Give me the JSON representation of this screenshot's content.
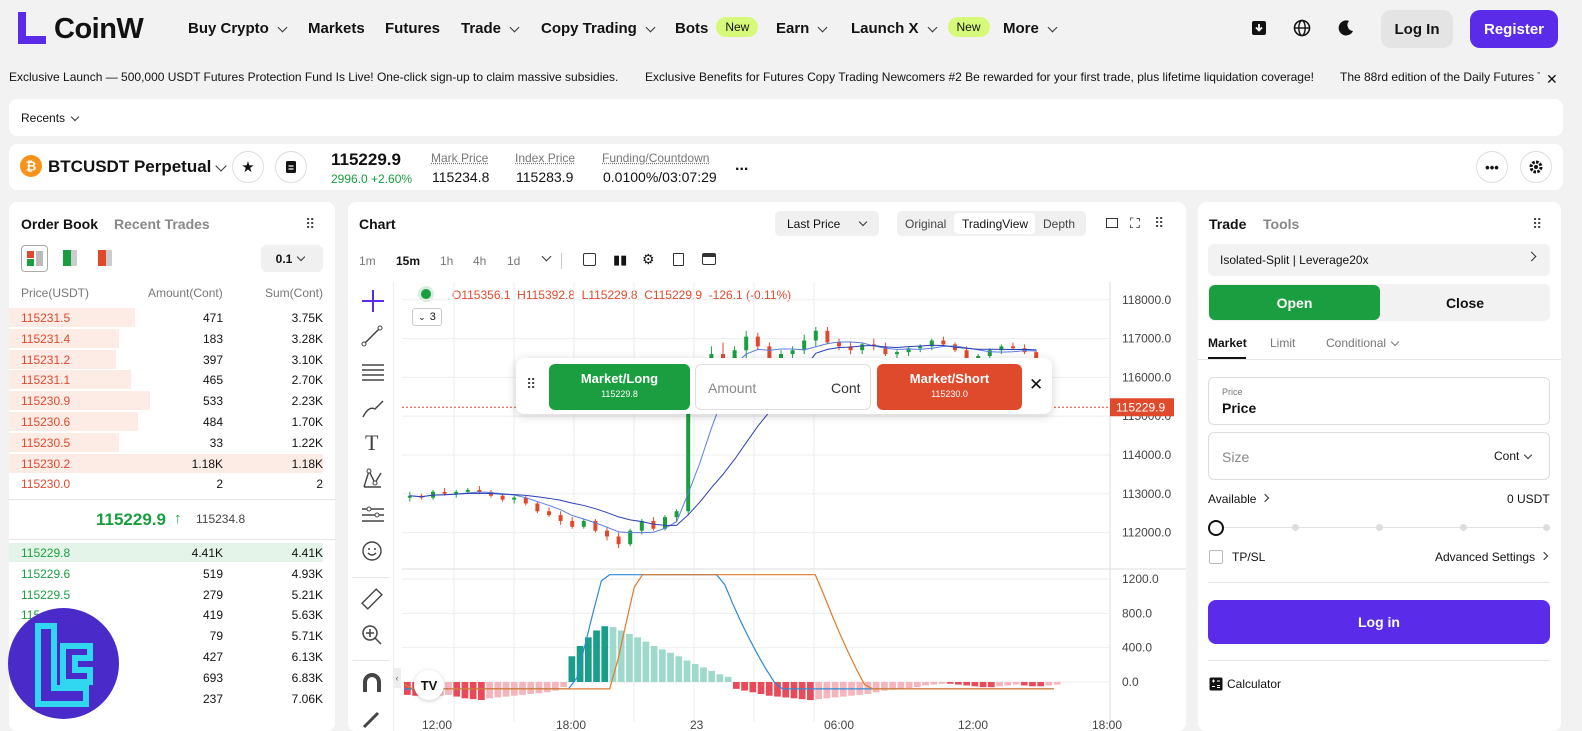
{
  "brand": {
    "name": "CoinW",
    "color": "#5a2be8"
  },
  "nav": {
    "items": [
      {
        "label": "Buy Crypto",
        "chevron": true
      },
      {
        "label": "Markets"
      },
      {
        "label": "Futures"
      },
      {
        "label": "Trade",
        "chevron": true
      },
      {
        "label": "Copy Trading",
        "chevron": true
      },
      {
        "label": "Bots",
        "badge": "New"
      },
      {
        "label": "Earn",
        "chevron": true
      },
      {
        "label": "Launch X",
        "chevron": true,
        "badge": "New"
      },
      {
        "label": "More",
        "chevron": true
      }
    ],
    "login": "Log In",
    "register": "Register"
  },
  "ticker": {
    "items": [
      "Exclusive Launch — 500,000 USDT Futures Protection Fund Is Live! One-click sign-up to claim massive subsidies.",
      "Exclusive Benefits for Futures Copy Trading Newcomers #2 Be rewarded for your first trade, plus lifetime liquidation coverage!",
      "The 88rd edition of the Daily Futures T"
    ]
  },
  "recents": "Recents",
  "symbol": {
    "name": "BTCUSDT Perpetual",
    "last": "115229.9",
    "change": "2996.0 +2.60%",
    "mark_label": "Mark Price",
    "mark": "115234.8",
    "index_label": "Index Price",
    "index": "115283.9",
    "funding_label": "Funding/Countdown",
    "funding": "0.0100%/03:07:29",
    "more": "..."
  },
  "orderbook": {
    "tabs": [
      "Order Book",
      "Recent Trades"
    ],
    "precision": "0.1",
    "headers": [
      "Price(USDT)",
      "Amount(Cont)",
      "Sum(Cont)"
    ],
    "asks": [
      {
        "price": "115231.5",
        "amount": "471",
        "sum": "3.75K",
        "depth": 0.4
      },
      {
        "price": "115231.4",
        "amount": "183",
        "sum": "3.28K",
        "depth": 0.35
      },
      {
        "price": "115231.2",
        "amount": "397",
        "sum": "3.10K",
        "depth": 0.34
      },
      {
        "price": "115231.1",
        "amount": "465",
        "sum": "2.70K",
        "depth": 0.39
      },
      {
        "price": "115230.9",
        "amount": "533",
        "sum": "2.23K",
        "depth": 0.45
      },
      {
        "price": "115230.6",
        "amount": "484",
        "sum": "1.70K",
        "depth": 0.41
      },
      {
        "price": "115230.5",
        "amount": "33",
        "sum": "1.22K",
        "depth": 0.35
      },
      {
        "price": "115230.2",
        "amount": "1.18K",
        "sum": "1.18K",
        "depth": 1.0
      },
      {
        "price": "115230.0",
        "amount": "2",
        "sum": "2",
        "depth": 0.0
      }
    ],
    "mid_price": "115229.9",
    "mid_mark": "115234.8",
    "bids": [
      {
        "price": "115229.8",
        "amount": "4.41K",
        "sum": "4.41K",
        "depth": 1.0
      },
      {
        "price": "115229.6",
        "amount": "519",
        "sum": "4.93K",
        "depth": 0.0
      },
      {
        "price": "115229.5",
        "amount": "279",
        "sum": "5.21K",
        "depth": 0.0
      },
      {
        "price": "115...",
        "amount": "419",
        "sum": "5.63K",
        "depth": 0.0
      },
      {
        "price": "",
        "amount": "79",
        "sum": "5.71K",
        "depth": 0.0
      },
      {
        "price": "",
        "amount": "427",
        "sum": "6.13K",
        "depth": 0.0
      },
      {
        "price": "",
        "amount": "693",
        "sum": "6.83K",
        "depth": 0.0
      },
      {
        "price": "",
        "amount": "237",
        "sum": "7.06K",
        "depth": 0.0
      }
    ]
  },
  "chart": {
    "title": "Chart",
    "price_type": "Last Price",
    "views": [
      "Original",
      "TradingView",
      "Depth"
    ],
    "intervals": [
      "1m",
      "15m",
      "1h",
      "4h",
      "1d"
    ],
    "ohlc": {
      "o": "O115356.1",
      "h": "H115392.8",
      "l": "L115229.8",
      "c": "C115229.9",
      "chg": "-126.1 (-0.11%)"
    },
    "indicator_count": "3",
    "price_axis": [
      "118000.0",
      "117000.0",
      "116000.0",
      "115000.0",
      "114000.0",
      "113000.0",
      "112000.0"
    ],
    "last_price_tag": "115229.9",
    "macd_axis": [
      "1200.0",
      "800.0",
      "400.0",
      "0.0"
    ],
    "time_axis": [
      "12:00",
      "18:00",
      "23",
      "06:00",
      "12:00",
      "18:00"
    ],
    "quick": {
      "long": "Market/Long",
      "long_price": "115229.8",
      "amount_placeholder": "Amount",
      "unit": "Cont",
      "short": "Market/Short",
      "short_price": "115230.0"
    }
  },
  "chart_data": {
    "type": "candlestick",
    "price_range": [
      111500,
      118200
    ],
    "candles": [
      [
        112900,
        113050,
        112800,
        112950
      ],
      [
        112950,
        113000,
        112850,
        112900
      ],
      [
        112900,
        113100,
        112850,
        113050
      ],
      [
        113050,
        113150,
        112950,
        113000
      ],
      [
        113000,
        113100,
        112900,
        113050
      ],
      [
        113050,
        113150,
        113000,
        113100
      ],
      [
        113100,
        113200,
        113000,
        113050
      ],
      [
        113050,
        113100,
        112900,
        112950
      ],
      [
        112950,
        113000,
        112800,
        112850
      ],
      [
        112850,
        112950,
        112750,
        112900
      ],
      [
        112900,
        112950,
        112700,
        112750
      ],
      [
        112750,
        112800,
        112500,
        112550
      ],
      [
        112550,
        112650,
        112400,
        112450
      ],
      [
        112450,
        112550,
        112200,
        112300
      ],
      [
        112300,
        112400,
        112100,
        112150
      ],
      [
        112150,
        112350,
        112100,
        112300
      ],
      [
        112300,
        112350,
        112000,
        112050
      ],
      [
        112050,
        112150,
        111800,
        111900
      ],
      [
        111900,
        112000,
        111600,
        111700
      ],
      [
        111700,
        112100,
        111650,
        112050
      ],
      [
        112050,
        112350,
        111950,
        112300
      ],
      [
        112300,
        112400,
        112050,
        112100
      ],
      [
        112100,
        112450,
        112050,
        112400
      ],
      [
        112400,
        112600,
        112300,
        112550
      ],
      [
        112550,
        115800,
        112450,
        115700
      ],
      [
        115700,
        116300,
        115400,
        116200
      ],
      [
        116200,
        116800,
        116000,
        116600
      ],
      [
        116600,
        116900,
        116300,
        116450
      ],
      [
        116450,
        116800,
        116350,
        116700
      ],
      [
        116700,
        117200,
        116500,
        117050
      ],
      [
        117050,
        117150,
        116700,
        116800
      ],
      [
        116800,
        116900,
        116400,
        116500
      ],
      [
        116500,
        116700,
        116350,
        116600
      ],
      [
        116600,
        116800,
        116500,
        116700
      ],
      [
        116700,
        117100,
        116600,
        116950
      ],
      [
        116950,
        117300,
        116800,
        117200
      ],
      [
        117200,
        117300,
        116850,
        116900
      ],
      [
        116900,
        117000,
        116700,
        116800
      ],
      [
        116800,
        116900,
        116600,
        116700
      ],
      [
        116700,
        116900,
        116600,
        116850
      ],
      [
        116850,
        117000,
        116700,
        116800
      ],
      [
        116800,
        116900,
        116550,
        116600
      ],
      [
        116600,
        116700,
        116500,
        116650
      ],
      [
        116650,
        116800,
        116550,
        116750
      ],
      [
        116750,
        116850,
        116650,
        116800
      ],
      [
        116800,
        117000,
        116700,
        116950
      ],
      [
        116950,
        117050,
        116800,
        116850
      ],
      [
        116850,
        116900,
        116650,
        116700
      ],
      [
        116700,
        116800,
        116450,
        116500
      ],
      [
        116500,
        116600,
        116350,
        116550
      ],
      [
        116550,
        116750,
        116500,
        116700
      ],
      [
        116700,
        116850,
        116600,
        116800
      ],
      [
        116800,
        116900,
        116700,
        116750
      ],
      [
        116750,
        116850,
        116600,
        116650
      ],
      [
        116650,
        116700,
        116450,
        116500
      ]
    ],
    "macd_hist": [
      -150,
      -160,
      -170,
      -180,
      -160,
      -150,
      -170,
      -190,
      -200,
      -210,
      -190,
      -180,
      -170,
      -160,
      -150,
      -140,
      -130,
      -120,
      -100,
      -60,
      300,
      420,
      520,
      600,
      650,
      640,
      600,
      560,
      520,
      470,
      420,
      380,
      340,
      300,
      250,
      210,
      170,
      130,
      90,
      60,
      -80,
      -100,
      -120,
      -140,
      -160,
      -170,
      -180,
      -190,
      -200,
      -210,
      -200,
      -190,
      -180,
      -170,
      -160,
      -150,
      -140,
      -120,
      -100,
      -90,
      -80,
      -70,
      -60,
      -40,
      -30,
      -20,
      -20,
      -30,
      -40,
      -50,
      -60,
      -60,
      -50,
      -40,
      -30,
      -40,
      -50,
      -50,
      -40,
      -30
    ]
  },
  "trade": {
    "tabs": [
      "Trade",
      "Tools"
    ],
    "mode": "Isolated-Split | Leverage20x",
    "open": "Open",
    "close": "Close",
    "order_types": [
      "Market",
      "Limit",
      "Conditional"
    ],
    "price_label": "Price",
    "price_value": "Price",
    "size_label": "Size",
    "size_unit": "Cont",
    "available_label": "Available",
    "available_value": "0 USDT",
    "tpsl": "TP/SL",
    "advanced": "Advanced Settings",
    "login": "Log in",
    "calculator": "Calculator"
  },
  "colors": {
    "up": "#1a9e3f",
    "down": "#e04a2c",
    "accent": "#5a2be8",
    "badge": "#d6f97a"
  }
}
